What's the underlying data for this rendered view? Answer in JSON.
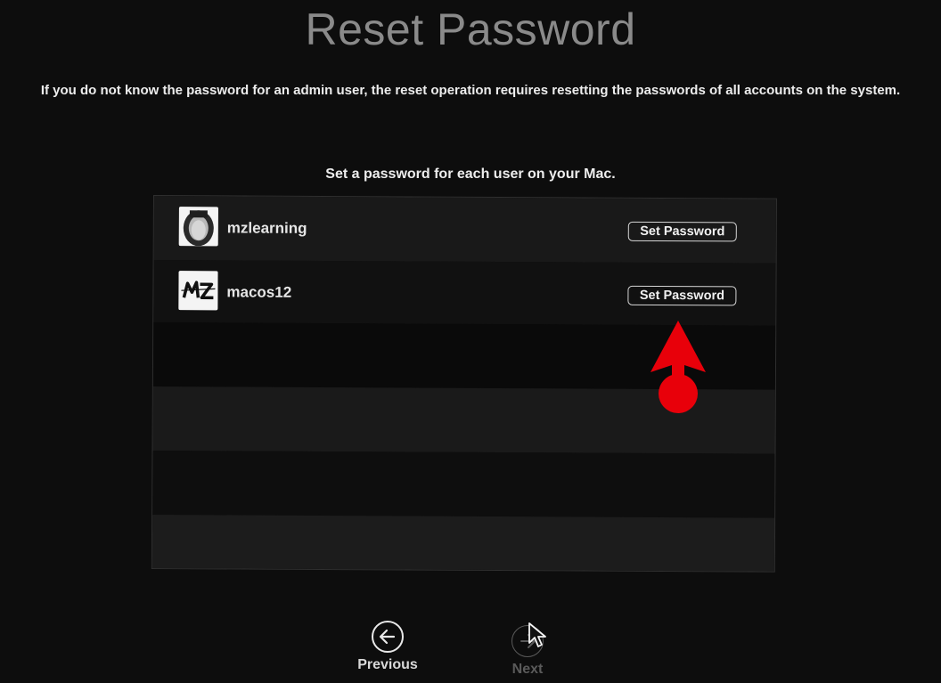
{
  "header": {
    "title": "Reset Password",
    "description": "If you do not know the password for an admin user, the reset operation requires resetting the passwords of all accounts on the system."
  },
  "main": {
    "instruction": "Set a password for each user on your Mac.",
    "users": [
      {
        "name": "mzlearning",
        "button_label": "Set Password",
        "avatar_icon": "person-photo-icon"
      },
      {
        "name": "macos12",
        "button_label": "Set Password",
        "avatar_icon": "mz-logo-icon"
      }
    ]
  },
  "footer": {
    "previous_label": "Previous",
    "next_label": "Next"
  },
  "colors": {
    "background": "#0d0d0d",
    "annotation_red": "#e8000a"
  }
}
